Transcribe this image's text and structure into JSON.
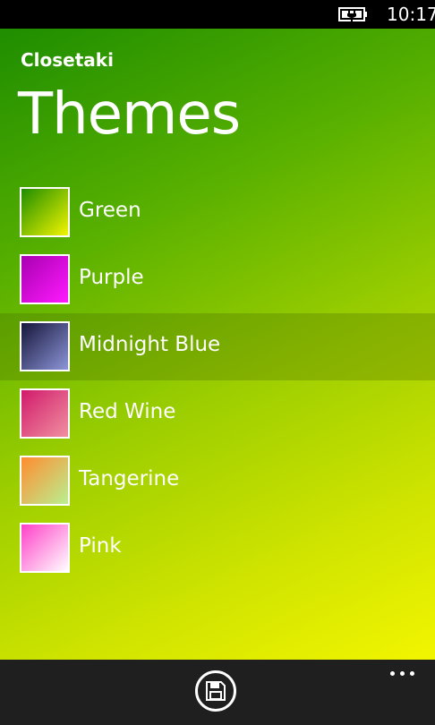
{
  "status_bar": {
    "time": "10:17",
    "battery_icon": "battery-charging-icon"
  },
  "header": {
    "app_title": "Closetaki",
    "page_title": "Themes"
  },
  "themes": [
    {
      "label": "Green",
      "colors": [
        "#1e8d00",
        "#f2f500"
      ],
      "selected": false
    },
    {
      "label": "Purple",
      "colors": [
        "#a800b0",
        "#ff1aff"
      ],
      "selected": false
    },
    {
      "label": "Midnight Blue",
      "colors": [
        "#16163a",
        "#8c95d8"
      ],
      "selected": true
    },
    {
      "label": "Red Wine",
      "colors": [
        "#d11a6b",
        "#f090a0"
      ],
      "selected": false
    },
    {
      "label": "Tangerine",
      "colors": [
        "#ff8c30",
        "#b9f090"
      ],
      "selected": false
    },
    {
      "label": "Pink",
      "colors": [
        "#ff40c8",
        "#ffffff"
      ],
      "selected": false
    }
  ],
  "app_bar": {
    "save_icon": "save-icon",
    "more_icon": "more-icon"
  }
}
